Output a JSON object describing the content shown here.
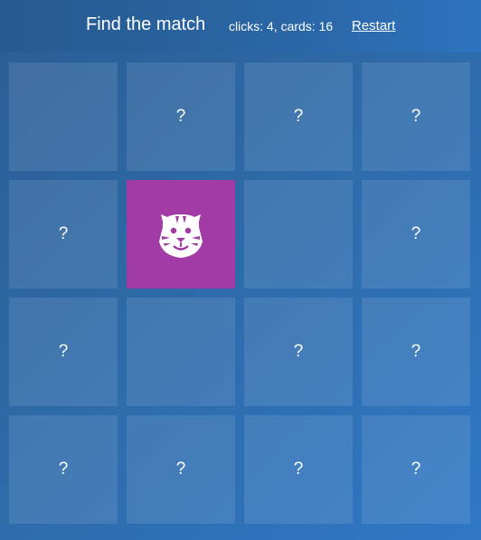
{
  "header": {
    "title": "Find the match",
    "status": "clicks: 4, cards: 16",
    "restart_label": "Restart"
  },
  "cards": [
    {
      "face": ""
    },
    {
      "face": "?"
    },
    {
      "face": "?"
    },
    {
      "face": "?"
    },
    {
      "face": "?"
    },
    {
      "face": "",
      "revealed": true,
      "icon": "tiger-icon",
      "color": "#a33ba6"
    },
    {
      "face": ""
    },
    {
      "face": "?"
    },
    {
      "face": "?"
    },
    {
      "face": ""
    },
    {
      "face": "?"
    },
    {
      "face": "?"
    },
    {
      "face": "?"
    },
    {
      "face": "?"
    },
    {
      "face": "?"
    },
    {
      "face": "?"
    }
  ]
}
